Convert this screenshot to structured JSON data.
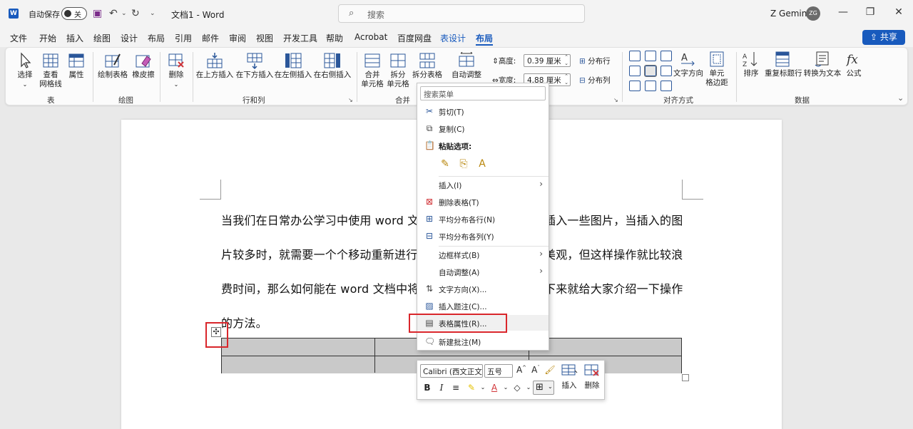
{
  "titlebar": {
    "app_icon_letter": "W",
    "autosave_label": "自动保存",
    "autosave_state": "关",
    "doc_title": "文档1 - Word",
    "search_placeholder": "搜索",
    "user_name": "Z Gemini",
    "user_initials": "ZG"
  },
  "tabs": [
    "文件",
    "开始",
    "插入",
    "绘图",
    "设计",
    "布局",
    "引用",
    "邮件",
    "审阅",
    "视图",
    "开发工具",
    "帮助",
    "Acrobat",
    "百度网盘",
    "表设计",
    "布局"
  ],
  "share_label": "共享",
  "ribbon": {
    "table_group": {
      "label": "表",
      "select": "选择",
      "gridlines": [
        "查看",
        "网格线"
      ],
      "properties": "属性"
    },
    "draw_group": {
      "label": "绘图",
      "draw_table": "绘制表格",
      "eraser": "橡皮擦"
    },
    "rowcol_group": {
      "label": "行和列",
      "delete": "删除",
      "insert_above": "在上方插入",
      "insert_below": "在下方插入",
      "insert_left": "在左侧插入",
      "insert_right": "在右侧插入"
    },
    "merge_group": {
      "label": "合并",
      "merge_cells": [
        "合并",
        "单元格"
      ],
      "split_cells": [
        "拆分",
        "单元格"
      ],
      "split_table": "拆分表格"
    },
    "cellsize_group": {
      "autofit": "自动调整",
      "height_label": "高度:",
      "height_value": "0.39 厘米",
      "width_label": "宽度:",
      "width_value": "4.88 厘米",
      "dist_rows": "分布行",
      "dist_cols": "分布列"
    },
    "align_group": {
      "label": "对齐方式",
      "text_direction": "文字方向",
      "cell_margins": [
        "单元",
        "格边距"
      ]
    },
    "data_group": {
      "label": "数据",
      "sort": "排序",
      "repeat_header": "重复标题行",
      "convert": "转换为文本",
      "formula": "公式"
    }
  },
  "document": {
    "lines": [
      "当我们在日常办公学习中使用 word 文",
      "插入一些图片，当插入的图",
      "片较多时，就需要一个个移动重新进行",
      "美观，但这样操作就比较浪",
      "费时间，那么如何能在 word 文档中将图",
      "下来就给大家介绍一下操作",
      "的方法。"
    ]
  },
  "context_menu": {
    "search_placeholder": "搜索菜单",
    "cut": "剪切(T)",
    "copy": "复制(C)",
    "paste_options": "粘贴选项:",
    "insert": "插入(I)",
    "delete_table": "删除表格(T)",
    "dist_rows": "平均分布各行(N)",
    "dist_cols": "平均分布各列(Y)",
    "border_styles": "边框样式(B)",
    "autofit": "自动调整(A)",
    "text_direction": "文字方向(X)...",
    "insert_caption": "插入题注(C)...",
    "table_properties": "表格属性(R)...",
    "new_comment": "新建批注(M)"
  },
  "mini_toolbar": {
    "font": "Calibri (西文正文",
    "size": "五号",
    "insert_label": "插入",
    "delete_label": "删除"
  },
  "colors": {
    "accent": "#185abd",
    "highlight_box": "#d9262b"
  }
}
